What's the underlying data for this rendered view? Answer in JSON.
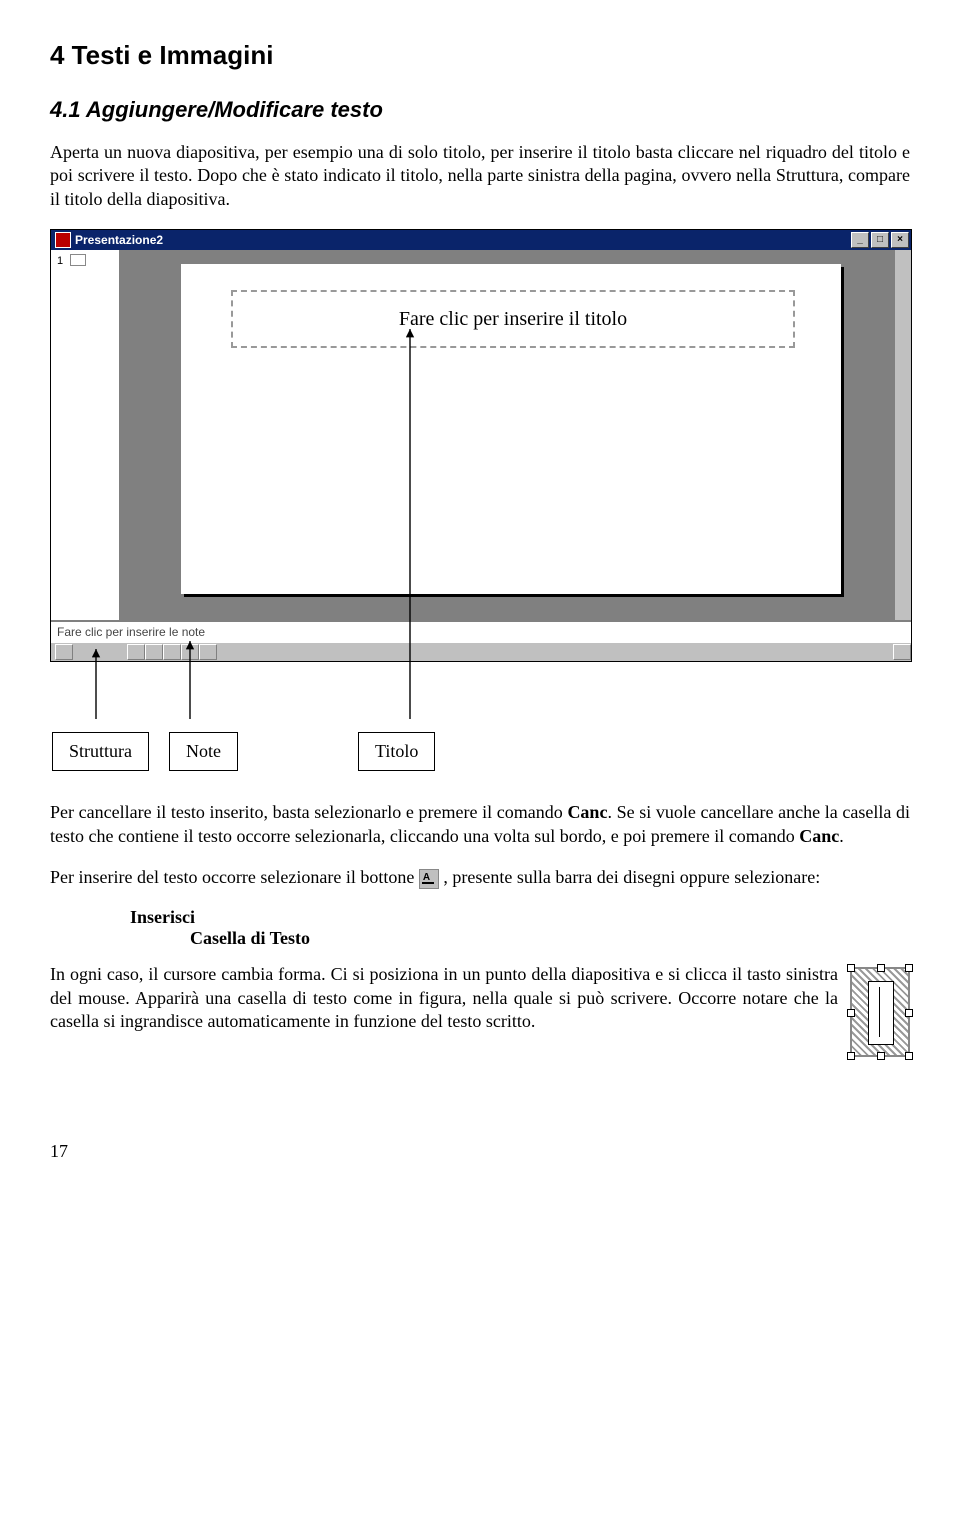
{
  "section_heading": "4  Testi e Immagini",
  "subsection_heading": "4.1  Aggiungere/Modificare testo",
  "para1": "Aperta un nuova diapositiva, per esempio una di solo titolo,  per inserire il titolo basta cliccare nel riquadro del titolo e poi scrivere il testo. Dopo che è stato indicato il titolo, nella parte sinistra della pagina, ovvero nella Struttura, compare il titolo della diapositiva.",
  "screenshot": {
    "window_title": "Presentazione2",
    "outline_number": "1",
    "title_placeholder": "Fare clic per inserire il titolo",
    "notes_placeholder": "Fare clic per inserire le note",
    "min_btn": "_",
    "max_btn": "□",
    "close_btn": "×"
  },
  "labels": {
    "struttura": "Struttura",
    "note": "Note",
    "titolo": "Titolo"
  },
  "para2_a": "Per cancellare il testo inserito, basta selezionarlo e premere il comando ",
  "para2_b": ". Se si vuole cancellare anche la casella di testo che contiene il testo occorre selezionarla, cliccando una volta sul bordo, e poi premere il comando ",
  "bold_canc": "Canc",
  "period": ".",
  "para3_a": "Per inserire del testo occorre selezionare il bottone ",
  "para3_b": " , presente sulla barra dei disegni oppure selezionare:",
  "menu_level1": "Inserisci",
  "menu_level2": "Casella di Testo",
  "para4": "In ogni caso, il cursore cambia forma. Ci si posiziona in un punto della diapositiva e si clicca il tasto sinistra del mouse. Apparirà una casella di testo come in figura, nella quale si può scrivere. Occorre notare che la casella si ingrandisce automaticamente in funzione del testo scritto.",
  "page_number": "17"
}
